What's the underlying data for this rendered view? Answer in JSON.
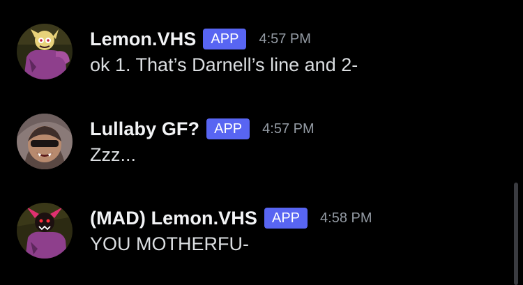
{
  "messages": [
    {
      "username": "Lemon.VHS",
      "badge": "APP",
      "timestamp": "4:57 PM",
      "content": "ok 1. That’s Darnell’s line and 2-",
      "avatar_icon": "lemon-demon-avatar"
    },
    {
      "username": "Lullaby GF?",
      "badge": "APP",
      "timestamp": "4:57 PM",
      "content": "Zzz...",
      "avatar_icon": "lullaby-gf-avatar"
    },
    {
      "username": "(MAD) Lemon.VHS",
      "badge": "APP",
      "timestamp": "4:58 PM",
      "content": "YOU MOTHERFU-",
      "avatar_icon": "mad-lemon-demon-avatar"
    }
  ],
  "colors": {
    "background": "#000000",
    "app_badge": "#5865f2",
    "timestamp": "#949ba4",
    "username": "#f2f3f5",
    "message_text": "#dbdee1"
  }
}
